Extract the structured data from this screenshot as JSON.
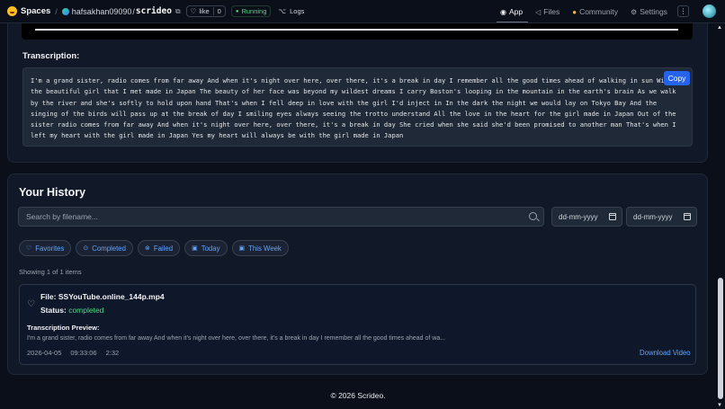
{
  "topbar": {
    "spaces_label": "Spaces",
    "owner": "hafsakhan09090",
    "slash": "/",
    "repo": "scrideo",
    "like_label": "like",
    "like_count": "0",
    "status": "Running",
    "logs_label": "Logs",
    "nav": [
      {
        "label": "App",
        "icon": "app-icon",
        "active": true
      },
      {
        "label": "Files",
        "icon": "files-icon",
        "active": false
      },
      {
        "label": "Community",
        "icon": "community-icon",
        "active": false
      },
      {
        "label": "Settings",
        "icon": "gear-icon",
        "active": false
      }
    ],
    "menu_label": "⋮"
  },
  "transcription": {
    "label": "Transcription:",
    "copy_label": "Copy",
    "text": "I'm a grand sister, radio comes from far away And when it's night over here, over there, it's a break in day I remember all the good times ahead of walking in sun With the beautiful girl that I met made in Japan The beauty of her face was beyond my wildest dreams I carry Boston's looping in the mountain in the earth's brain As we walk by the river and she's softly to hold upon hand That's when I fell deep in love with the girl I'd inject in In the dark the night we would lay on Tokyo Bay And the singing of the birds will pass up at the break of day I smiling eyes always seeing the trotto understand All the love in the heart for the girl made in Japan Out of the sister radio comes from far away And when it's night over here, over there, it's a break in day She cried when she said she'd been promised to another man That's when I left my heart with the girl made in Japan Yes my heart will always be with the girl made in Japan"
  },
  "history": {
    "title": "Your History",
    "search_placeholder": "Search by filename...",
    "date_placeholder_1": "dd-mm-yyyy",
    "date_placeholder_2": "dd-mm-yyyy",
    "filters": [
      {
        "label": "Favorites",
        "icon": "heart-icon"
      },
      {
        "label": "Completed",
        "icon": "check-circle-icon"
      },
      {
        "label": "Failed",
        "icon": "x-circle-icon"
      },
      {
        "label": "Today",
        "icon": "calendar-icon"
      },
      {
        "label": "This Week",
        "icon": "calendar-icon"
      }
    ],
    "showing": "Showing 1 of 1 items",
    "item": {
      "file_label": "File:",
      "file_name": "SSYouTube.online_144p.mp4",
      "status_label": "Status:",
      "status_value": "completed",
      "preview_label": "Transcription Preview:",
      "preview_text": "I'm a grand sister, radio comes from far away And when it's night over here, over there, it's a break in day I remember all the good times ahead of wa...",
      "date": "2026-04-05",
      "time": "09:33:06",
      "duration": "2:32",
      "download_label": "Download Video"
    }
  },
  "footer": {
    "text": "© 2026 Scrideo."
  },
  "colors": {
    "background": "#0b0f19",
    "card": "#111827",
    "accent": "#2563eb",
    "link": "#60a5fa",
    "success": "#4ade80"
  }
}
